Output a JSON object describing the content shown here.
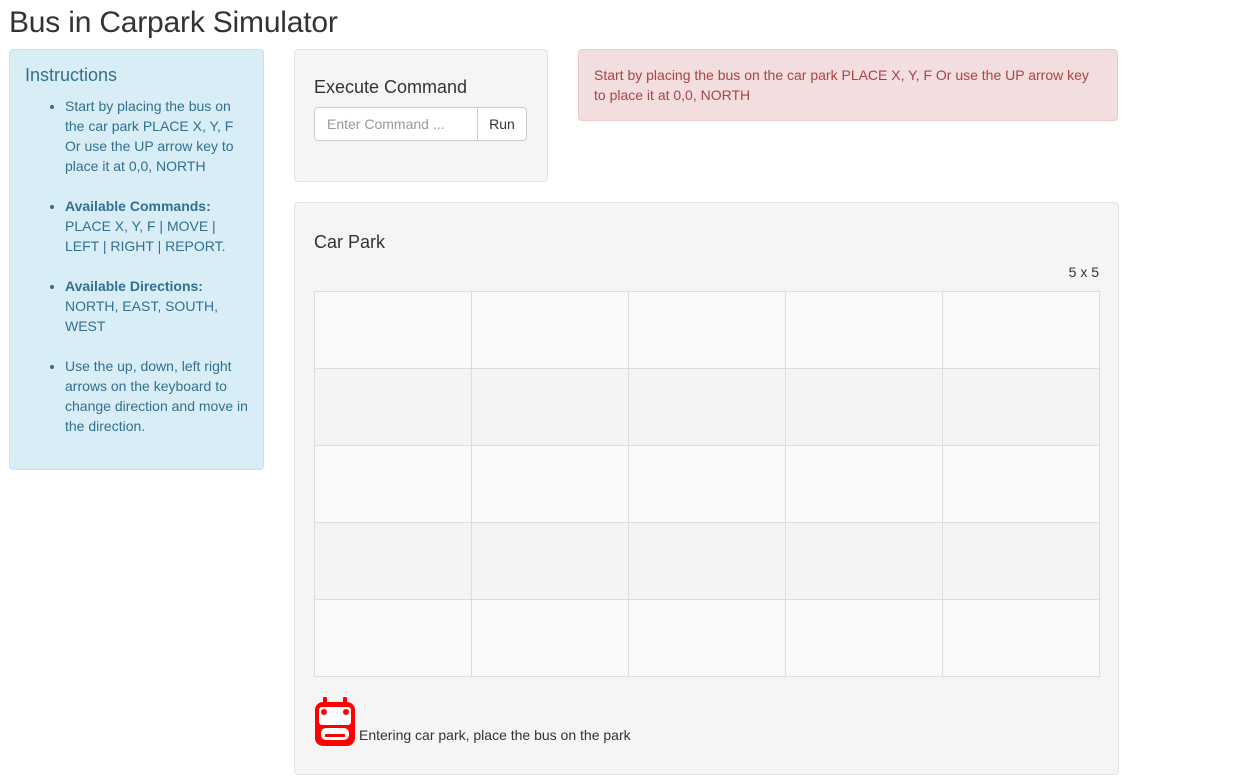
{
  "page": {
    "title": "Bus in Carpark Simulator"
  },
  "instructions": {
    "heading": "Instructions",
    "items": [
      {
        "bold": "",
        "text": "Start by placing the bus on the car park PLACE X, Y, F Or use the UP arrow key to place it at 0,0, NORTH"
      },
      {
        "bold": "Available Commands:",
        "text": "PLACE X, Y, F | MOVE | LEFT | RIGHT | REPORT."
      },
      {
        "bold": "Available Directions:",
        "text": "NORTH, EAST, SOUTH, WEST"
      },
      {
        "bold": "",
        "text": "Use the up, down, left right arrows on the keyboard to change direction and move in the direction."
      }
    ]
  },
  "command": {
    "heading": "Execute Command",
    "input_value": "",
    "placeholder": "Enter Command ...",
    "run_label": "Run"
  },
  "alert": {
    "text": "Start by placing the bus on the car park PLACE X, Y, F Or use the UP arrow key to place it at 0,0, NORTH"
  },
  "car_park": {
    "heading": "Car Park",
    "size_label": "5 x 5",
    "rows": 5,
    "cols": 5,
    "status_text": "Entering car park, place the bus on the park",
    "bus_icon": "bus-icon",
    "bus_color": "#ff0000"
  },
  "colors": {
    "info_bg": "#d9edf7",
    "info_text": "#31708f",
    "danger_bg": "#f2dede",
    "danger_text": "#a94442",
    "panel_bg": "#f5f5f5"
  }
}
